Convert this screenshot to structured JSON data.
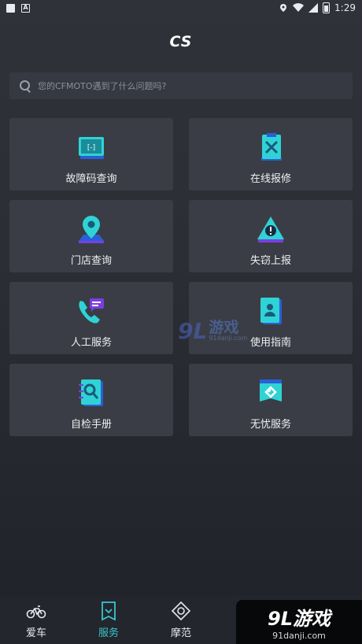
{
  "status_bar": {
    "time": "1:29"
  },
  "header": {
    "title": "CS"
  },
  "search": {
    "placeholder": "您的CFMOTO遇到了什么问题吗?"
  },
  "cards": [
    {
      "label": "故障码查询",
      "icon": "fault-code-icon"
    },
    {
      "label": "在线报修",
      "icon": "repair-tools-icon"
    },
    {
      "label": "门店查询",
      "icon": "store-location-icon"
    },
    {
      "label": "失窃上报",
      "icon": "theft-alert-icon"
    },
    {
      "label": "人工服务",
      "icon": "phone-chat-icon"
    },
    {
      "label": "使用指南",
      "icon": "user-guide-icon"
    },
    {
      "label": "自检手册",
      "icon": "self-check-manual-icon"
    },
    {
      "label": "无忧服务",
      "icon": "worry-free-icon"
    }
  ],
  "tabs": [
    {
      "label": "爱车",
      "icon": "motorcycle-icon",
      "active": false
    },
    {
      "label": "服务",
      "icon": "service-bookmark-icon",
      "active": true
    },
    {
      "label": "摩范",
      "icon": "compass-icon",
      "active": false
    }
  ],
  "watermark": {
    "main": "游戏",
    "brand": "9L",
    "site": "91danji.com"
  },
  "colors": {
    "accent": "#38c6cf",
    "icon_cyan": "#2fd3d6",
    "icon_blue": "#2a5fd6",
    "icon_purple": "#7a3ee0",
    "card_bg": "#3a3d45"
  }
}
